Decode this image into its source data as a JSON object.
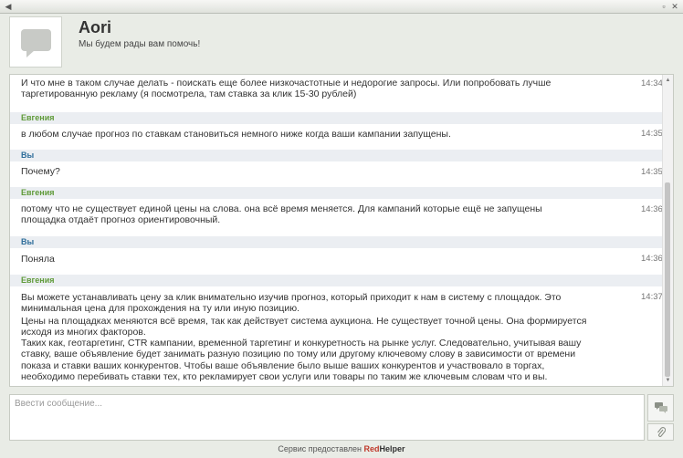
{
  "header": {
    "name": "Aori",
    "subtitle": "Мы будем рады вам помочь!"
  },
  "messages": [
    {
      "text": "И что мне в таком случае делать - поискать еще более низкочастотные и недорогие запросы. Или попробовать лучше таргетированную рекламу (я посмотрела, там ставка за клик 15-30 рублей)",
      "time": "14:34"
    },
    {
      "author": "Евгения",
      "text": "в любом случае прогноз по ставкам становиться немного ниже когда ваши кампании запущены.",
      "time": "14:35"
    },
    {
      "author": "Вы",
      "text": "Почему?",
      "time": "14:35"
    },
    {
      "author": "Евгения",
      "text": "потому что не существует единой цены на слова. она всё время меняется. Для кампаний которые ещё не запущены площадка отдаёт прогноз ориентировочный.",
      "time": "14:36"
    },
    {
      "author": "Вы",
      "text": "Поняла",
      "time": "14:36"
    },
    {
      "author": "Евгения",
      "text": "Вы можете устанавливать цену за клик внимательно изучив прогноз, который приходит к нам в систему с площадок. Это минимальная цена для прохождения на ту или иную позицию.",
      "text2": "Цены на площадках меняются всё время, так как действует система аукциона. Не существует точной цены. Она формируется исходя из многих факторов.",
      "text3": "Таких как, геотаргетинг, CTR кампании, временной таргетинг и конкуретность на рынке услуг. Следовательно, учитывая вашу ставку, ваше объявление будет занимать разную позицию по тому или другому ключевому слову в зависимости от времени показа и ставки ваших конкурентов. Чтобы ваше объявление было выше ваших конкурентов и участвовало в торгах, необходимо перебивать ставки тех, кто рекламирует свои услуги или товары по таким же ключевым словам что и вы.",
      "time": "14:37"
    }
  ],
  "composer": {
    "placeholder": "Ввести сообщение..."
  },
  "footer": {
    "prefix": "Сервис предоставлен",
    "brand_red": "Red",
    "brand_rest": "Helper"
  }
}
